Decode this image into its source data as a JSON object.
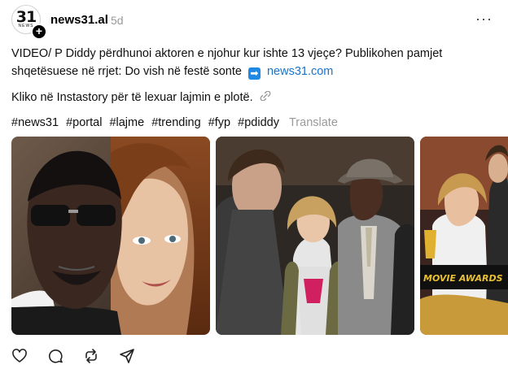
{
  "post": {
    "avatar_big": "31",
    "avatar_small": "NEWS",
    "follow_symbol": "+",
    "username": "news31.al",
    "time": "5d",
    "more": "···",
    "line1": "VIDEO/ P Diddy përdhunoi aktoren e njohur kur ishte 13 vjeçe? Publikohen pamjet",
    "line2": "shqetësuese në rrjet: Do vish në festë sonte",
    "arrow": "➡",
    "link": "news31.com",
    "line3": "Kliko në Instastory për të lexuar lajmin e plotë.",
    "tags": [
      "#news31",
      "#portal",
      "#lajme",
      "#trending",
      "#fyp",
      "#pdiddy"
    ],
    "translate": "Translate"
  },
  "media": {
    "photo3_caption": "MOVIE AWARDS",
    "icons": [
      "man-sunglasses-photo-icon",
      "group-photo-icon",
      "award-stage-photo-icon"
    ]
  },
  "actions": [
    "like-icon",
    "comment-icon",
    "repost-icon",
    "share-icon"
  ],
  "colors": {
    "link": "#1a73c8",
    "muted": "#999999",
    "arrow_bg": "#1e88e5"
  }
}
